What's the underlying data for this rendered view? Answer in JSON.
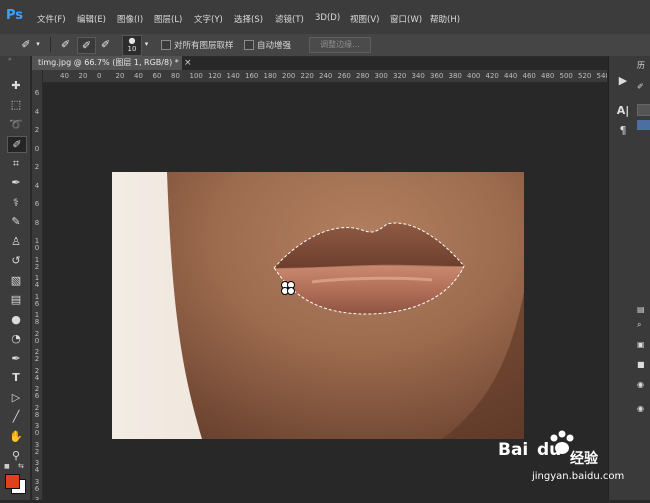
{
  "app": {
    "logo": "Ps"
  },
  "menu": [
    "文件(F)",
    "编辑(E)",
    "图像(I)",
    "图层(L)",
    "文字(Y)",
    "选择(S)",
    "滤镜(T)",
    "3D(D)",
    "视图(V)",
    "窗口(W)",
    "帮助(H)"
  ],
  "options": {
    "brush_size": "10",
    "sample_all_layers_label": "对所有图层取样",
    "auto_enhance_label": "自动增强",
    "refine_edge_label": "调整边缘..."
  },
  "document": {
    "tab_title": "timg.jpg @ 66.7% (图层 1, RGB/8) *",
    "tab_close": "×"
  },
  "ruler": {
    "horizontal": [
      "40",
      "20",
      "0",
      "20",
      "40",
      "60",
      "80",
      "100",
      "120",
      "140",
      "160",
      "180",
      "200",
      "220",
      "240",
      "260",
      "280",
      "300",
      "320",
      "340",
      "360",
      "380",
      "400",
      "420",
      "440",
      "460",
      "480",
      "500",
      "520",
      "540",
      "560",
      "580"
    ],
    "vertical": [
      "6",
      "4",
      "2",
      "0",
      "2",
      "4",
      "6",
      "8",
      "1 0",
      "1 2",
      "1 4",
      "1 6",
      "1 8",
      "2 0",
      "2 2",
      "2 4",
      "2 6",
      "2 8",
      "3 0",
      "3 2",
      "3 4",
      "3 6",
      "3 8"
    ]
  },
  "right_panel": {
    "top_label": "历"
  },
  "watermark": {
    "brand": "Bai",
    "brand2": "du",
    "cn": "经验",
    "url": "jingyan.baidu.com"
  },
  "colors": {
    "accent": "#3fa0ff",
    "foreground_swatch": "#e0401c",
    "background_swatch": "#ffffff"
  }
}
